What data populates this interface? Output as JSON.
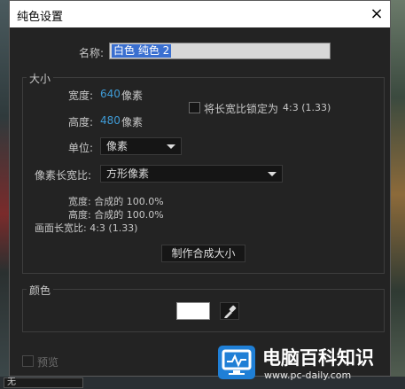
{
  "window": {
    "title": "纯色设置",
    "close_icon": "×"
  },
  "name": {
    "label": "名称:",
    "value": "白色 纯色 2"
  },
  "size": {
    "section_title": "大小",
    "width_label": "宽度:",
    "width_value": "640",
    "height_label": "高度:",
    "height_value": "480",
    "unit_pixels": "像素",
    "lock_label": "将长宽比锁定为",
    "lock_ratio": "4:3 (1.33)",
    "unit_label": "单位:",
    "unit_value": "像素",
    "pixel_aspect_label": "像素长宽比:",
    "pixel_aspect_value": "方形像素",
    "info_width": "宽度: 合成的 100.0%",
    "info_height": "高度: 合成的 100.0%",
    "info_frame": "画面长宽比: 4:3 (1.33)",
    "make_comp_button": "制作合成大小"
  },
  "color": {
    "section_title": "颜色",
    "swatch_color": "#ffffff"
  },
  "preview": {
    "label": "预览"
  },
  "background": {
    "field_text": "无"
  },
  "watermark": {
    "title": "电脑百科知识",
    "url": "www.pc-daily.com"
  }
}
